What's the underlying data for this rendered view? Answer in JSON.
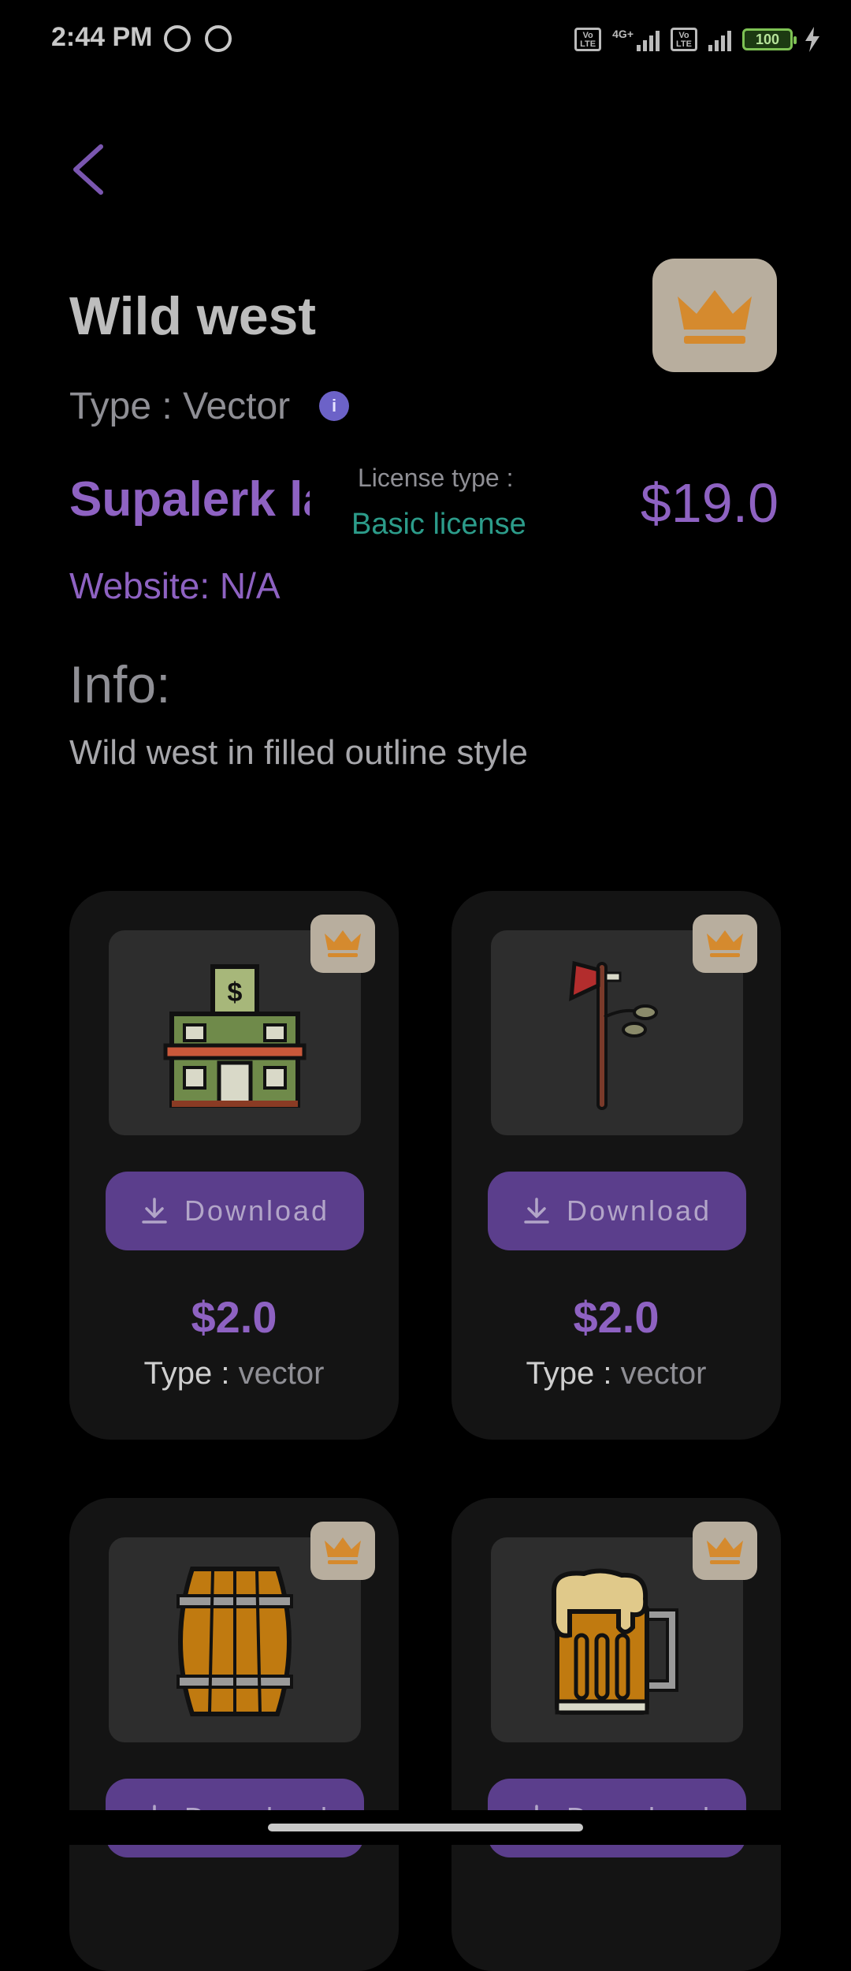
{
  "status_bar": {
    "time": "2:44 PM",
    "network": "4G+",
    "battery": "100"
  },
  "header": {
    "title": "Wild west",
    "type_line": "Type : Vector",
    "info_icon": "i",
    "author": "Supalerk la",
    "license_label": "License type :",
    "license_value": "Basic license",
    "price": "$19.0",
    "website": "Website: N/A",
    "info_heading": "Info:",
    "info_text": "Wild west in filled outline style"
  },
  "colors": {
    "accent": "#8e62c2",
    "button": "#5b3e8c",
    "license": "#2c9c8a",
    "badge": "#b8ae9e",
    "crown": "#d58a2e"
  },
  "cards": [
    {
      "icon": "saloon-building-icon",
      "download_label": "Download",
      "price": "$2.0",
      "type_label": "Type :",
      "type_value": "vector"
    },
    {
      "icon": "tomahawk-icon",
      "download_label": "Download",
      "price": "$2.0",
      "type_label": "Type :",
      "type_value": "vector"
    },
    {
      "icon": "barrel-icon",
      "download_label": "Download"
    },
    {
      "icon": "beer-mug-icon",
      "download_label": "Download"
    }
  ]
}
